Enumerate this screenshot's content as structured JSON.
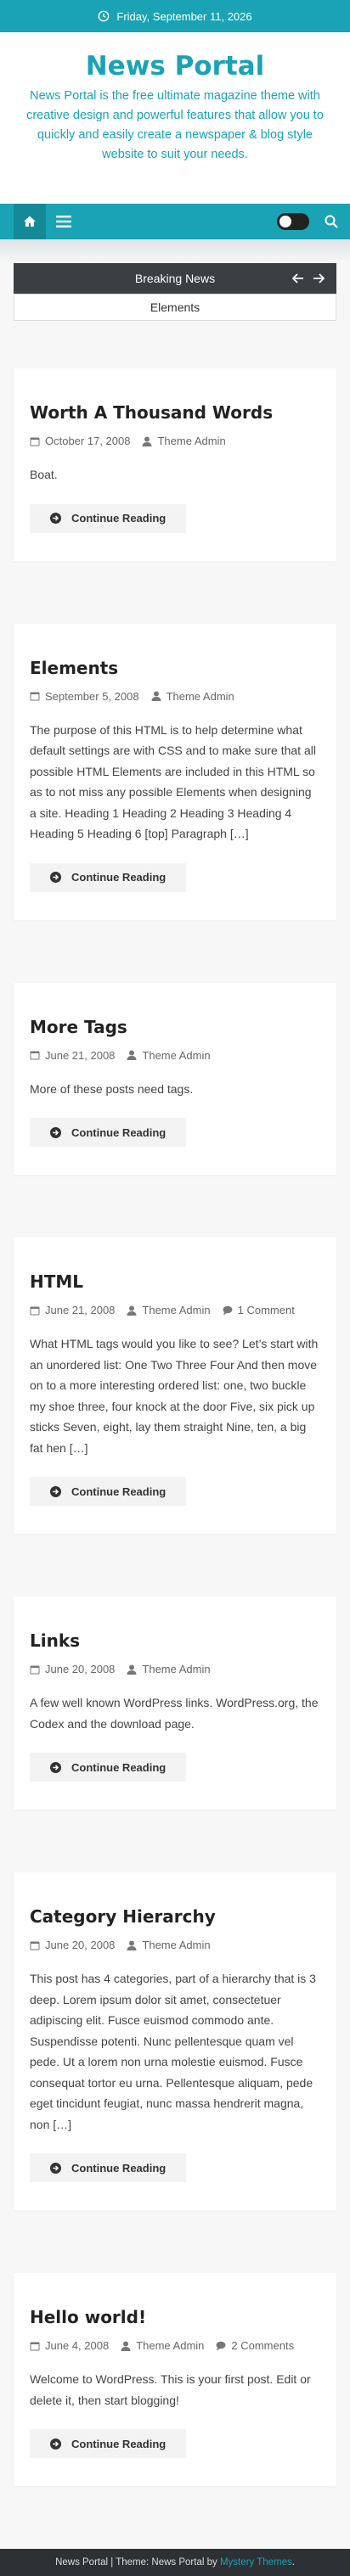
{
  "topbar": {
    "date": "Friday, September 11, 2026"
  },
  "header": {
    "title": "News Portal",
    "description": "News Portal is the free ultimate magazine theme with creative design and powerful features that allow you to quickly and easily create a newspaper & blog style website to suit your needs."
  },
  "breaking": {
    "heading": "Breaking News",
    "item": "Elements"
  },
  "posts": [
    {
      "title": "Worth A Thousand Words",
      "date": "October 17, 2008",
      "author": "Theme Admin",
      "comments": "",
      "excerpt": "Boat.",
      "button": "Continue Reading"
    },
    {
      "title": "Elements",
      "date": "September 5, 2008",
      "author": "Theme Admin",
      "comments": "",
      "excerpt": "The purpose of this HTML is to help determine what default settings are with CSS and to make sure that all possible HTML Elements are included in this HTML so as to not miss any possible Elements when designing a site. Heading 1 Heading 2 Heading 3 Heading 4 Heading 5 Heading 6 [top] Paragraph […]",
      "button": "Continue Reading"
    },
    {
      "title": "More Tags",
      "date": "June 21, 2008",
      "author": "Theme Admin",
      "comments": "",
      "excerpt": "More of these posts need tags.",
      "button": "Continue Reading"
    },
    {
      "title": "HTML",
      "date": "June 21, 2008",
      "author": "Theme Admin",
      "comments": "1 Comment",
      "excerpt": "What HTML tags would you like to see? Let’s start with an unordered list: One Two Three Four And then move on to a more interesting ordered list: one, two buckle my shoe three, four knock at the door Five, six pick up sticks Seven, eight, lay them straight Nine, ten, a big fat hen […]",
      "button": "Continue Reading"
    },
    {
      "title": "Links",
      "date": "June 20, 2008",
      "author": "Theme Admin",
      "comments": "",
      "excerpt": "A few well known WordPress links. WordPress.org, the Codex and the download page.",
      "button": "Continue Reading"
    },
    {
      "title": "Category Hierarchy",
      "date": "June 20, 2008",
      "author": "Theme Admin",
      "comments": "",
      "excerpt": "This post has 4 categories, part of a hierarchy that is 3 deep. Lorem ipsum dolor sit amet, consectetuer adipiscing elit. Fusce euismod commodo ante. Suspendisse potenti. Nunc pellentesque quam vel pede. Ut a lorem non urna molestie euismod. Fusce consequat tortor eu urna. Pellentesque aliquam, pede eget tincidunt feugiat, nunc massa hendrerit magna, non […]",
      "button": "Continue Reading"
    },
    {
      "title": "Hello world!",
      "date": "June 4, 2008",
      "author": "Theme Admin",
      "comments": "2 Comments",
      "excerpt": "Welcome to WordPress. This is your first post. Edit or delete it, then start blogging!",
      "button": "Continue Reading"
    }
  ],
  "footer": {
    "text": "News Portal | Theme: News Portal by ",
    "link": "Mystery Themes",
    "suffix": "."
  },
  "colors": {
    "accent": "#1aa3b4",
    "dark": "#3a3f44",
    "footer": "#2d3034"
  }
}
